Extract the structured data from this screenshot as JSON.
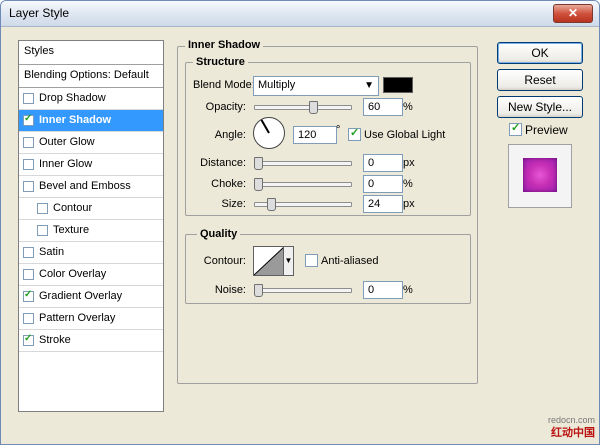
{
  "window": {
    "title": "Layer Style",
    "close_label": "✕"
  },
  "left_panel": {
    "header": "Styles",
    "blending": "Blending Options: Default",
    "items": [
      {
        "label": "Drop Shadow",
        "checked": false,
        "selected": false,
        "indent": false
      },
      {
        "label": "Inner Shadow",
        "checked": true,
        "selected": true,
        "indent": false
      },
      {
        "label": "Outer Glow",
        "checked": false,
        "selected": false,
        "indent": false
      },
      {
        "label": "Inner Glow",
        "checked": false,
        "selected": false,
        "indent": false
      },
      {
        "label": "Bevel and Emboss",
        "checked": false,
        "selected": false,
        "indent": false
      },
      {
        "label": "Contour",
        "checked": false,
        "selected": false,
        "indent": true
      },
      {
        "label": "Texture",
        "checked": false,
        "selected": false,
        "indent": true
      },
      {
        "label": "Satin",
        "checked": false,
        "selected": false,
        "indent": false
      },
      {
        "label": "Color Overlay",
        "checked": false,
        "selected": false,
        "indent": false
      },
      {
        "label": "Gradient Overlay",
        "checked": true,
        "selected": false,
        "indent": false
      },
      {
        "label": "Pattern Overlay",
        "checked": false,
        "selected": false,
        "indent": false
      },
      {
        "label": "Stroke",
        "checked": true,
        "selected": false,
        "indent": false
      }
    ]
  },
  "inner_shadow": {
    "title": "Inner Shadow",
    "structure": {
      "title": "Structure",
      "blend_mode_label": "Blend Mode:",
      "blend_mode_value": "Multiply",
      "shadow_color": "#000000",
      "opacity_label": "Opacity:",
      "opacity_value": "60",
      "opacity_unit": "%",
      "opacity_fraction": 0.6,
      "angle_label": "Angle:",
      "angle_value": "120",
      "angle_unit": "°",
      "use_global_light_label": "Use Global Light",
      "use_global_light_checked": true,
      "distance_label": "Distance:",
      "distance_value": "0",
      "distance_unit": "px",
      "choke_label": "Choke:",
      "choke_value": "0",
      "choke_unit": "%",
      "size_label": "Size:",
      "size_value": "24",
      "size_unit": "px"
    },
    "quality": {
      "title": "Quality",
      "contour_label": "Contour:",
      "anti_aliased_label": "Anti-aliased",
      "anti_aliased_checked": false,
      "noise_label": "Noise:",
      "noise_value": "0",
      "noise_unit": "%"
    }
  },
  "buttons": {
    "ok": "OK",
    "reset": "Reset",
    "new_style": "New Style..."
  },
  "preview": {
    "label": "Preview",
    "checked": true
  },
  "watermark": {
    "line1": "redocn.com",
    "line2": "红动中国"
  },
  "colors": {
    "selection": "#3399ff",
    "checkmark": "#21a121",
    "dialog_bg": "#ece9d8"
  }
}
